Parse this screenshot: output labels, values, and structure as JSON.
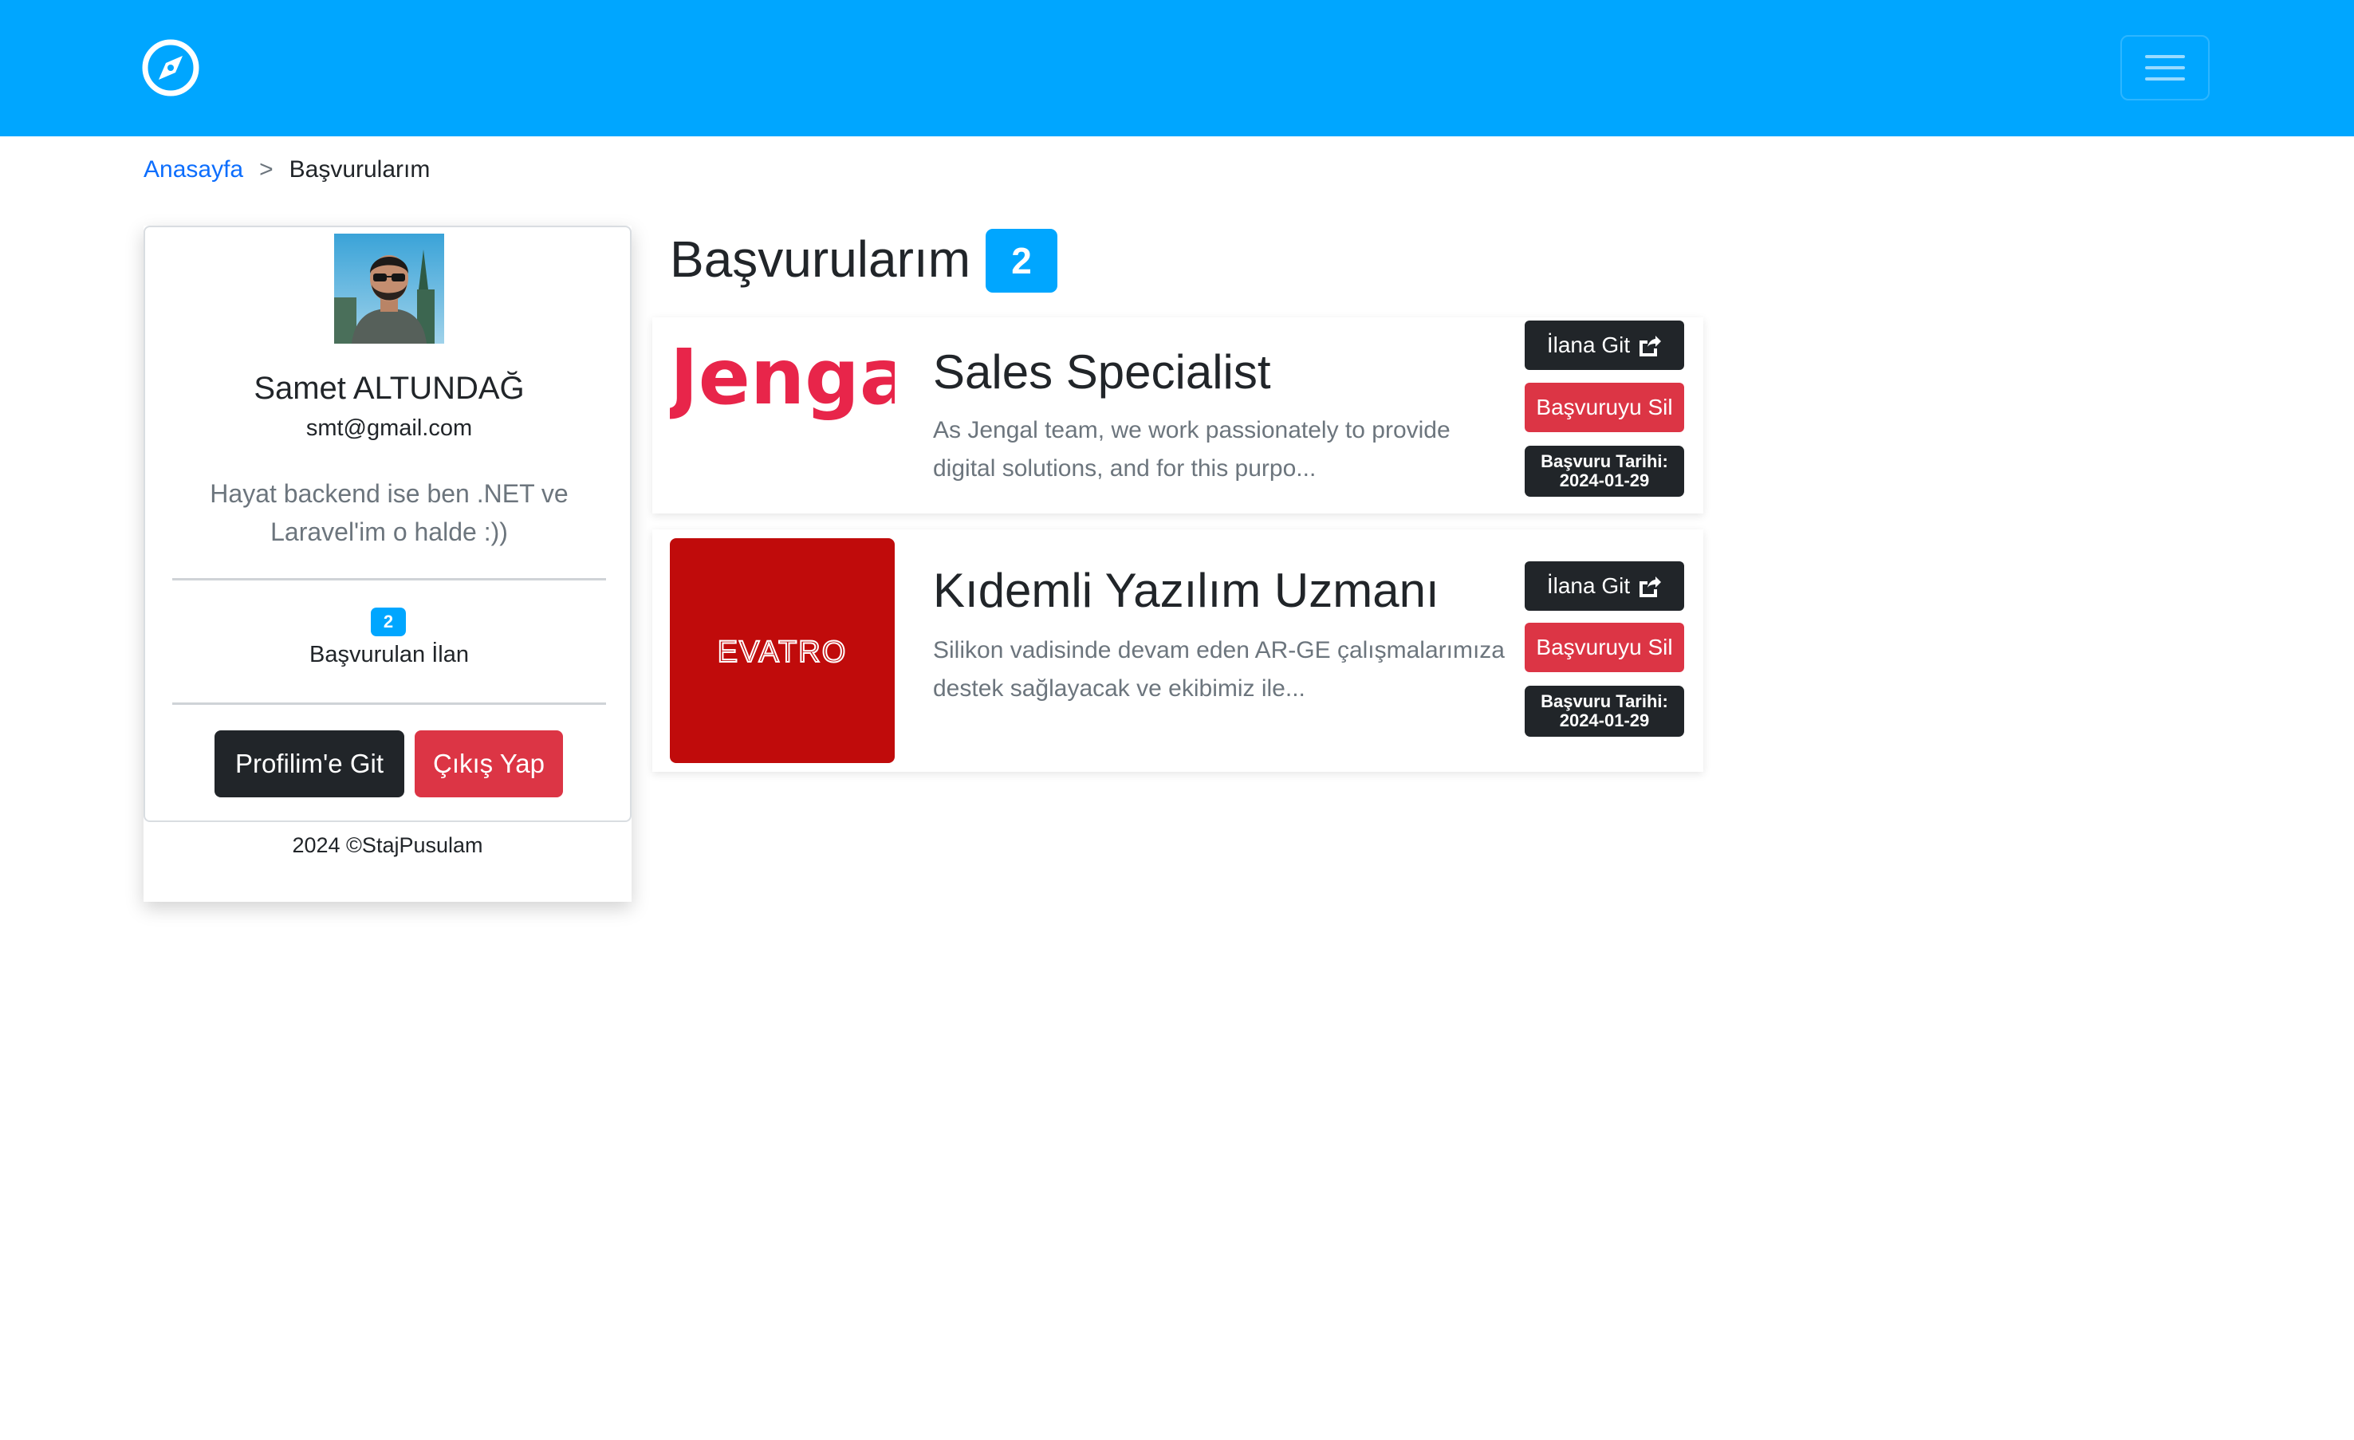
{
  "colors": {
    "navbar": "#00a6ff",
    "accent": "#00a6ff",
    "dark_button": "#212529",
    "danger_button": "#dc3545",
    "link": "#0d6efd"
  },
  "navbar": {
    "brand_icon": "compass-icon",
    "menu_icon": "hamburger-menu-icon"
  },
  "breadcrumb": {
    "home": "Anasayfa",
    "separator": ">",
    "current": "Başvurularım"
  },
  "profile": {
    "name": "Samet ALTUNDAĞ",
    "email": "smt@gmail.com",
    "bio": "Hayat backend ise ben .NET ve Laravel'im o halde :))",
    "applied_count": "2",
    "applied_label": "Başvurulan İlan",
    "profile_button": "Profilim'e Git",
    "logout_button": "Çıkış Yap",
    "footer": "2024 ©StajPusulam"
  },
  "main": {
    "title": "Başvurularım",
    "count": "2"
  },
  "applications": [
    {
      "company": "Jengal",
      "logo_text": "Jengal",
      "title": "Sales Specialist",
      "description": "As Jengal team, we work passionately to provide digital solutions, and for this purpo...",
      "go_button": "İlana Git",
      "delete_button": "Başvuruyu Sil",
      "date_label": "Başvuru Tarihi:",
      "date": "2024-01-29"
    },
    {
      "company": "Evatro",
      "logo_text": "EVATRO",
      "title": "Kıdemli Yazılım Uzmanı",
      "description": "Silikon vadisinde devam eden AR-GE çalışmalarımıza destek sağlayacak ve ekibimiz ile...",
      "go_button": "İlana Git",
      "delete_button": "Başvuruyu Sil",
      "date_label": "Başvuru Tarihi:",
      "date": "2024-01-29"
    }
  ]
}
